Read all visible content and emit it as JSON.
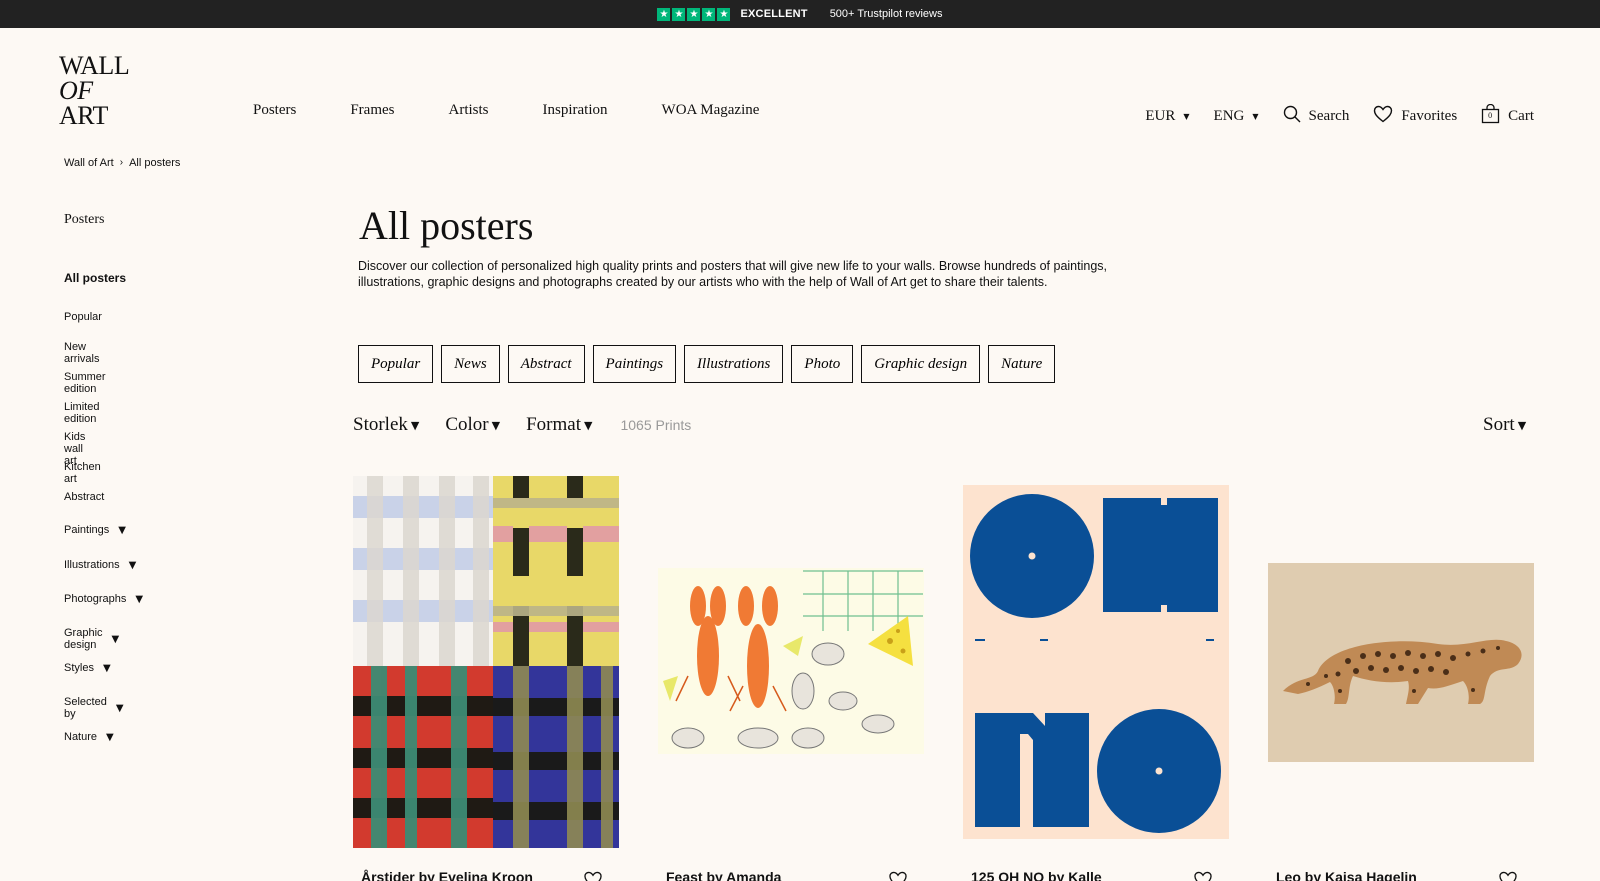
{
  "trustpilot": {
    "stars": "★★★★★",
    "rating": "EXCELLENT",
    "reviews": "500+ Trustpilot reviews"
  },
  "logo": [
    "WALL",
    "OF",
    "ART"
  ],
  "nav": [
    "Posters",
    "Frames",
    "Artists",
    "Inspiration",
    "WOA Magazine"
  ],
  "header_right": {
    "currency": "EUR",
    "language": "ENG",
    "search": "Search",
    "favorites": "Favorites",
    "cart": "Cart",
    "cart_count": "0"
  },
  "breadcrumb": [
    "Wall of Art",
    "All posters"
  ],
  "sidebar": {
    "title": "Posters",
    "current": "All posters",
    "items": [
      {
        "label": "Popular",
        "expandable": false
      },
      {
        "label": "New arrivals",
        "expandable": false
      },
      {
        "label": "Summer edition",
        "expandable": false
      },
      {
        "label": "Limited edition",
        "expandable": false
      },
      {
        "label": "Kids wall art",
        "expandable": false
      },
      {
        "label": "Kitchen art",
        "expandable": false
      },
      {
        "label": "Abstract",
        "expandable": false
      },
      {
        "label": "Paintings",
        "expandable": true
      },
      {
        "label": "Illustrations",
        "expandable": true
      },
      {
        "label": "Photographs",
        "expandable": true
      },
      {
        "label": "Graphic design",
        "expandable": true
      },
      {
        "label": "Styles",
        "expandable": true
      },
      {
        "label": "Selected by",
        "expandable": true
      },
      {
        "label": "Nature",
        "expandable": true
      }
    ]
  },
  "main": {
    "title": "All posters",
    "intro": "Discover our collection of personalized high quality prints and posters that will give new life to your walls. Browse hundreds of paintings, illustrations, graphic designs and photographs created by our artists who with the help of Wall of Art get to share their talents.",
    "chips": [
      "Popular",
      "News",
      "Abstract",
      "Paintings",
      "Illustrations",
      "Photo",
      "Graphic design",
      "Nature"
    ],
    "filters": [
      "Storlek",
      "Color",
      "Format"
    ],
    "count": "1065 Prints",
    "sort": "Sort"
  },
  "products": [
    {
      "name": "Årstider by Evelina Kroon"
    },
    {
      "name": "Feast by Amanda"
    },
    {
      "name": "125 OH NO by Kalle"
    },
    {
      "name": "Leo by Kajsa Hagelin"
    }
  ],
  "colors": {
    "background": "#fdf9f4",
    "topbar": "#222222",
    "trustpilot_green": "#00b67a",
    "oh_no_blue": "#0a4f96",
    "oh_no_bg": "#fde3cf",
    "leo_bg": "#dfccb0"
  }
}
